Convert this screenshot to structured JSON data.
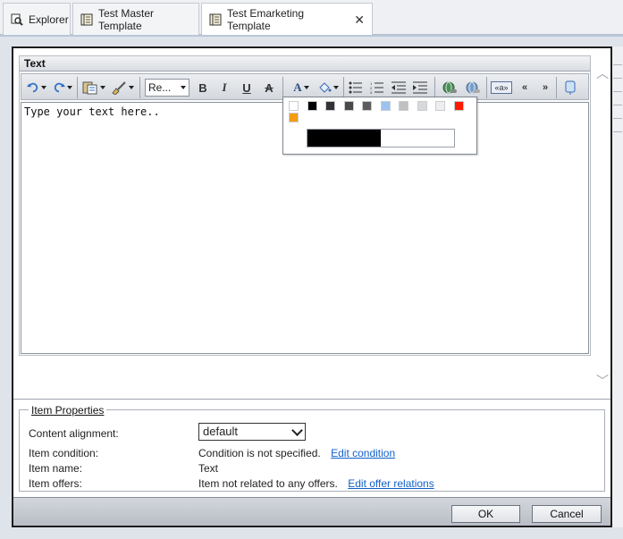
{
  "tabs": [
    {
      "label": "Explorer",
      "icon": "explorer-icon"
    },
    {
      "label": "Test Master Template",
      "icon": "template-icon"
    },
    {
      "label": "Test Emarketing Template",
      "icon": "template-icon",
      "active": true,
      "close": "✕"
    }
  ],
  "editor": {
    "section_title": "Text",
    "format_select": "Re...",
    "content": "Type your text here.."
  },
  "toolbar": {
    "bold": "B",
    "italic": "I",
    "underline": "U",
    "strike": "A",
    "font_color": "A",
    "insert_field": "«a»",
    "quote_open": "«",
    "quote_close": "»"
  },
  "color_picker": {
    "swatches": [
      "#ffffff",
      "#000000",
      "#333333",
      "#4a4a4a",
      "#5d5d5d",
      "#9cc3f0",
      "#c0c0c0",
      "#d9d9d9",
      "#eeeeee",
      "#ff1a00",
      "#f39c12"
    ],
    "gradient": {
      "start": "#000000",
      "end": "#ffffff",
      "level": 0.5
    }
  },
  "properties": {
    "legend": "Item Properties",
    "alignment_label": "Content alignment:",
    "alignment_value": "default",
    "condition_label": "Item condition:",
    "condition_value": "Condition is not specified.",
    "condition_link": "Edit condition",
    "name_label": "Item name:",
    "name_value": "Text",
    "offers_label": "Item offers:",
    "offers_value": "Item not related to any offers.",
    "offers_link": "Edit offer relations"
  },
  "buttons": {
    "ok": "OK",
    "cancel": "Cancel"
  },
  "colors": {
    "link": "#1260c9",
    "dialog_border": "#1d1d1d"
  }
}
